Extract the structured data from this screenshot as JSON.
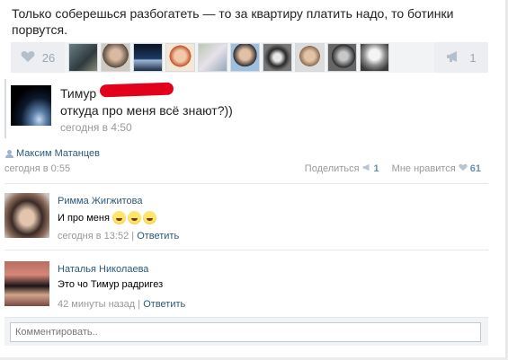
{
  "post": {
    "text": "Только соберешься разбогатеть — то за квартиру платить надо, то ботинки порвутся.",
    "likes_count": "26",
    "shares_count": "1"
  },
  "quote": {
    "name": "Тимур",
    "text": "откуда про меня всё знают?))",
    "time": "сегодня в 4:50"
  },
  "author": {
    "name": "Максим Матанцев",
    "time": "сегодня в 0:55"
  },
  "actions": {
    "share_label": "Поделиться",
    "share_count": "1",
    "like_label": "Мне нравится",
    "like_count": "61"
  },
  "comments": [
    {
      "name": "Римма Жигжитова",
      "text": "И про меня",
      "time": "сегодня в 13:52",
      "separator": "|",
      "reply_label": "Ответить"
    },
    {
      "name": "Наталья Николаева",
      "text": "Это чо Тимур радригез",
      "time": "42 минуты назад",
      "separator": "|",
      "reply_label": "Ответить"
    }
  ],
  "comment_form": {
    "placeholder": "Комментировать.."
  }
}
